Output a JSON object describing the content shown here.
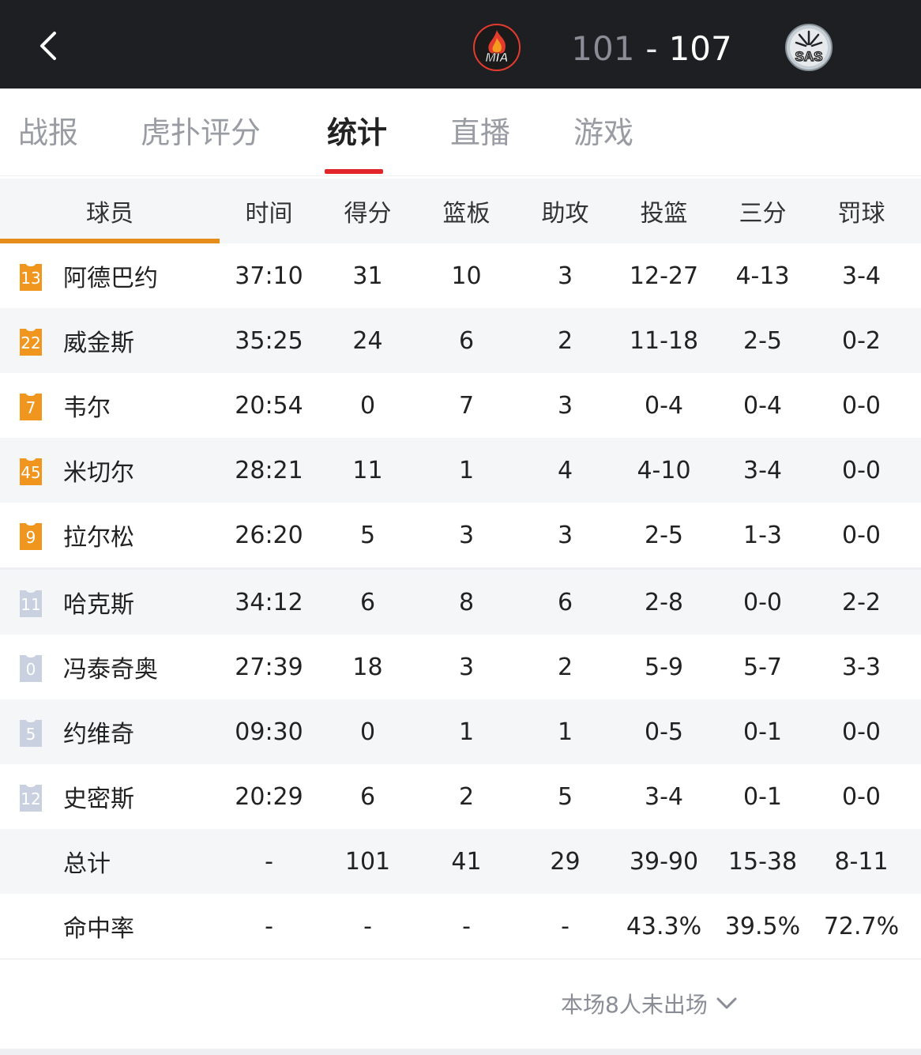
{
  "header": {
    "home_team": "MIA",
    "away_team": "SAS",
    "home_score": "101",
    "separator": "-",
    "away_score": "107"
  },
  "tabs": [
    {
      "label": "战报"
    },
    {
      "label": "虎扑评分"
    },
    {
      "label": "统计",
      "active": true
    },
    {
      "label": "直播"
    },
    {
      "label": "游戏"
    }
  ],
  "columns": [
    "球员",
    "时间",
    "得分",
    "篮板",
    "助攻",
    "投篮",
    "三分",
    "罚球"
  ],
  "players": [
    {
      "number": "13",
      "name": "阿德巴约",
      "time": "37:10",
      "pts": "31",
      "reb": "10",
      "ast": "3",
      "fg": "12-27",
      "three": "4-13",
      "ft": "3-4",
      "team": "home"
    },
    {
      "number": "22",
      "name": "威金斯",
      "time": "35:25",
      "pts": "24",
      "reb": "6",
      "ast": "2",
      "fg": "11-18",
      "three": "2-5",
      "ft": "0-2",
      "team": "home"
    },
    {
      "number": "7",
      "name": "韦尔",
      "time": "20:54",
      "pts": "0",
      "reb": "7",
      "ast": "3",
      "fg": "0-4",
      "three": "0-4",
      "ft": "0-0",
      "team": "home"
    },
    {
      "number": "45",
      "name": "米切尔",
      "time": "28:21",
      "pts": "11",
      "reb": "1",
      "ast": "4",
      "fg": "4-10",
      "three": "3-4",
      "ft": "0-0",
      "team": "home"
    },
    {
      "number": "9",
      "name": "拉尔松",
      "time": "26:20",
      "pts": "5",
      "reb": "3",
      "ast": "3",
      "fg": "2-5",
      "three": "1-3",
      "ft": "0-0",
      "team": "home"
    },
    {
      "number": "11",
      "name": "哈克斯",
      "time": "34:12",
      "pts": "6",
      "reb": "8",
      "ast": "6",
      "fg": "2-8",
      "three": "0-0",
      "ft": "2-2",
      "team": "bench"
    },
    {
      "number": "0",
      "name": "冯泰奇奥",
      "time": "27:39",
      "pts": "18",
      "reb": "3",
      "ast": "2",
      "fg": "5-9",
      "three": "5-7",
      "ft": "3-3",
      "team": "bench"
    },
    {
      "number": "5",
      "name": "约维奇",
      "time": "09:30",
      "pts": "0",
      "reb": "1",
      "ast": "1",
      "fg": "0-5",
      "three": "0-1",
      "ft": "0-0",
      "team": "bench"
    },
    {
      "number": "12",
      "name": "史密斯",
      "time": "20:29",
      "pts": "6",
      "reb": "2",
      "ast": "5",
      "fg": "3-4",
      "three": "0-1",
      "ft": "0-0",
      "team": "bench"
    }
  ],
  "totals": {
    "label": "总计",
    "time": "-",
    "pts": "101",
    "reb": "41",
    "ast": "29",
    "fg": "39-90",
    "three": "15-38",
    "ft": "8-11"
  },
  "percent": {
    "label": "命中率",
    "time": "-",
    "pts": "-",
    "reb": "-",
    "ast": "-",
    "fg": "43.3%",
    "three": "39.5%",
    "ft": "72.7%"
  },
  "footer": {
    "not_played": "本场8人未出场"
  },
  "icons": {
    "back": "chevron-left-icon",
    "expand": "chevron-down-icon",
    "jersey": "jersey-icon"
  },
  "colors": {
    "header_bg": "#1e1f23",
    "accent_red": "#e1252b",
    "jersey_starter": "#f0961e",
    "jersey_bench": "#c9d1e0",
    "head_underline": "#e58c1a"
  }
}
